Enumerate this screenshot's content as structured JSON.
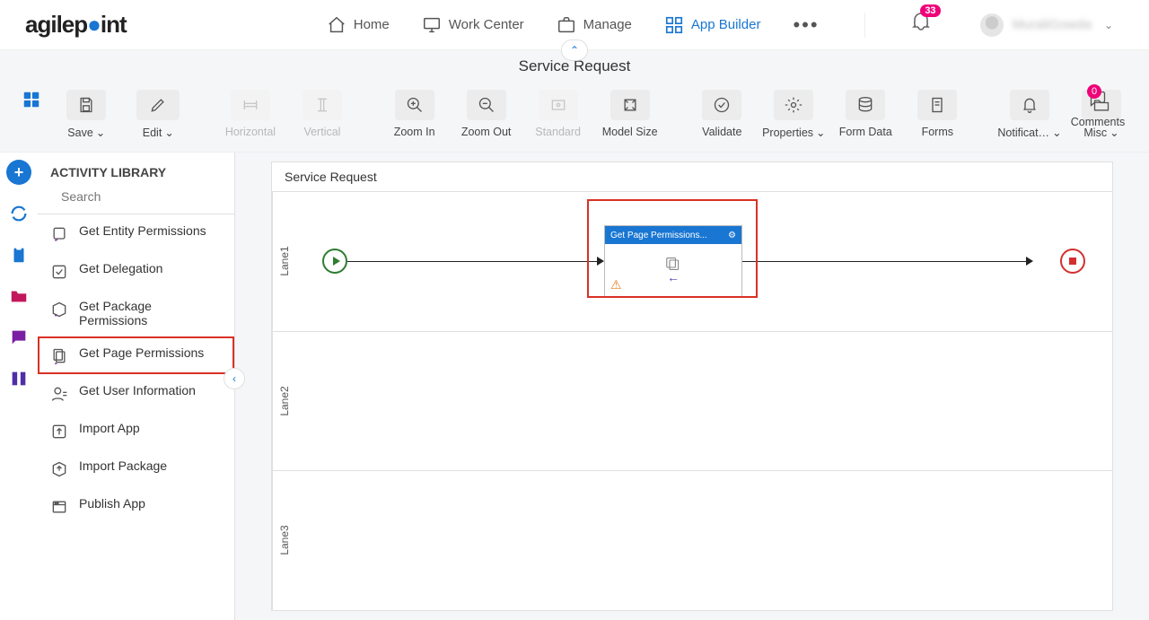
{
  "brand": {
    "part1": "agilep",
    "part2": "",
    "part3": "int"
  },
  "nav": {
    "home": "Home",
    "work_center": "Work Center",
    "manage": "Manage",
    "app_builder": "App Builder"
  },
  "notifications_count": "33",
  "user_name": "MuraliGowda",
  "page_title": "Service Request",
  "toolbar": {
    "save": "Save",
    "edit": "Edit",
    "horizontal": "Horizontal",
    "vertical": "Vertical",
    "zoom_in": "Zoom In",
    "zoom_out": "Zoom Out",
    "standard": "Standard",
    "model_size": "Model Size",
    "validate": "Validate",
    "properties": "Properties",
    "form_data": "Form Data",
    "forms": "Forms",
    "notifications": "Notificat…",
    "misc": "Misc",
    "comments": "Comments",
    "comments_count": "0"
  },
  "library": {
    "title": "ACTIVITY LIBRARY",
    "search_placeholder": "Search",
    "items": [
      {
        "label": "Get Entity Permissions"
      },
      {
        "label": "Get Delegation"
      },
      {
        "label": "Get Package Permissions"
      },
      {
        "label": "Get Page Permissions"
      },
      {
        "label": "Get User Information"
      },
      {
        "label": "Import App"
      },
      {
        "label": "Import Package"
      },
      {
        "label": "Publish App"
      }
    ]
  },
  "canvas": {
    "title": "Service Request",
    "lanes": [
      "Lane1",
      "Lane2",
      "Lane3"
    ],
    "activity_label": "Get Page Permissions..."
  }
}
